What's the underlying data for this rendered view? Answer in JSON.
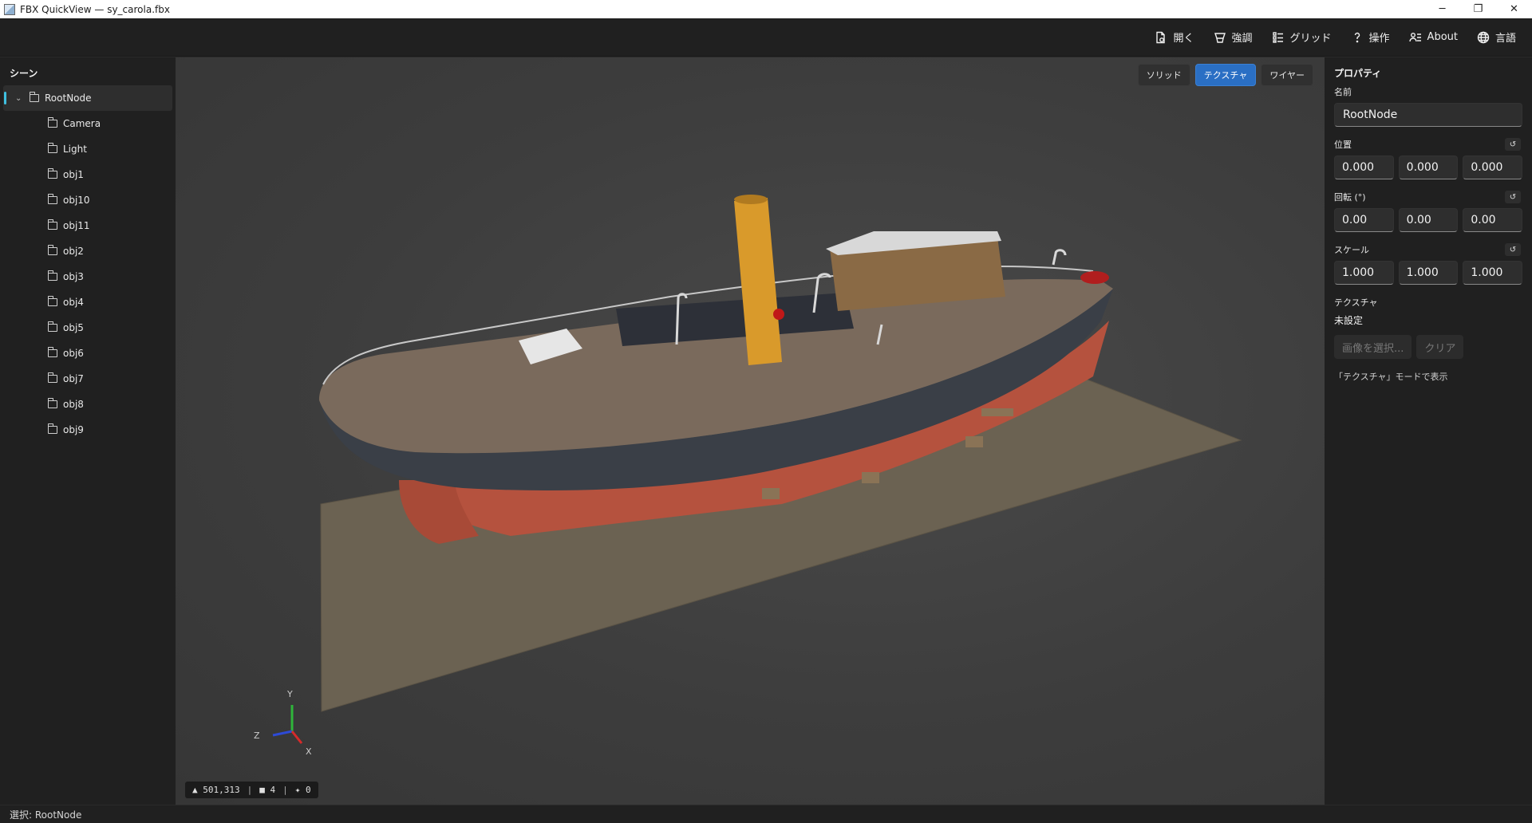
{
  "window": {
    "title": "FBX QuickView — sy_carola.fbx",
    "controls": {
      "minimize": "─",
      "maximize": "❐",
      "close": "✕"
    }
  },
  "toolbar": {
    "items": [
      {
        "label": "開く",
        "icon": "open-file-icon"
      },
      {
        "label": "強調",
        "icon": "highlight-icon"
      },
      {
        "label": "グリッド",
        "icon": "grid-list-icon"
      },
      {
        "label": "操作",
        "icon": "help-icon"
      },
      {
        "label": "About",
        "icon": "about-icon"
      },
      {
        "label": "言語",
        "icon": "globe-icon"
      }
    ]
  },
  "scene": {
    "title": "シーン",
    "root": {
      "label": "RootNode",
      "expanded": true,
      "selected": true
    },
    "children": [
      "Camera",
      "Light",
      "obj1",
      "obj10",
      "obj11",
      "obj2",
      "obj3",
      "obj4",
      "obj5",
      "obj6",
      "obj7",
      "obj8",
      "obj9"
    ]
  },
  "viewport": {
    "modes": [
      {
        "label": "ソリッド",
        "active": false
      },
      {
        "label": "テクスチャ",
        "active": true
      },
      {
        "label": "ワイヤー",
        "active": false
      }
    ],
    "stats": {
      "triangles": "▲ 501,313",
      "meshes": "■ 4",
      "lights": "✦ 0",
      "sep": "|"
    },
    "axes": {
      "y": "Y",
      "z": "Z",
      "x": "X"
    },
    "colors": {
      "ground": "#6b6252",
      "hull_dark": "#3a3f47",
      "hull_red": "#b5523e",
      "funnel": "#d99a2b",
      "deck": "#7a6a5c"
    }
  },
  "properties": {
    "title": "プロパティ",
    "name_label": "名前",
    "name_value": "RootNode",
    "position_label": "位置",
    "position": [
      "0.000",
      "0.000",
      "0.000"
    ],
    "rotation_label": "回転 (°)",
    "rotation": [
      "0.00",
      "0.00",
      "0.00"
    ],
    "scale_label": "スケール",
    "scale": [
      "1.000",
      "1.000",
      "1.000"
    ],
    "reset_glyph": "↺",
    "texture_label": "テクスチャ",
    "texture_value": "未設定",
    "select_image_button": "画像を選択...",
    "clear_button": "クリア",
    "hint": "「テクスチャ」モードで表示"
  },
  "status": {
    "text": "選択: RootNode"
  }
}
